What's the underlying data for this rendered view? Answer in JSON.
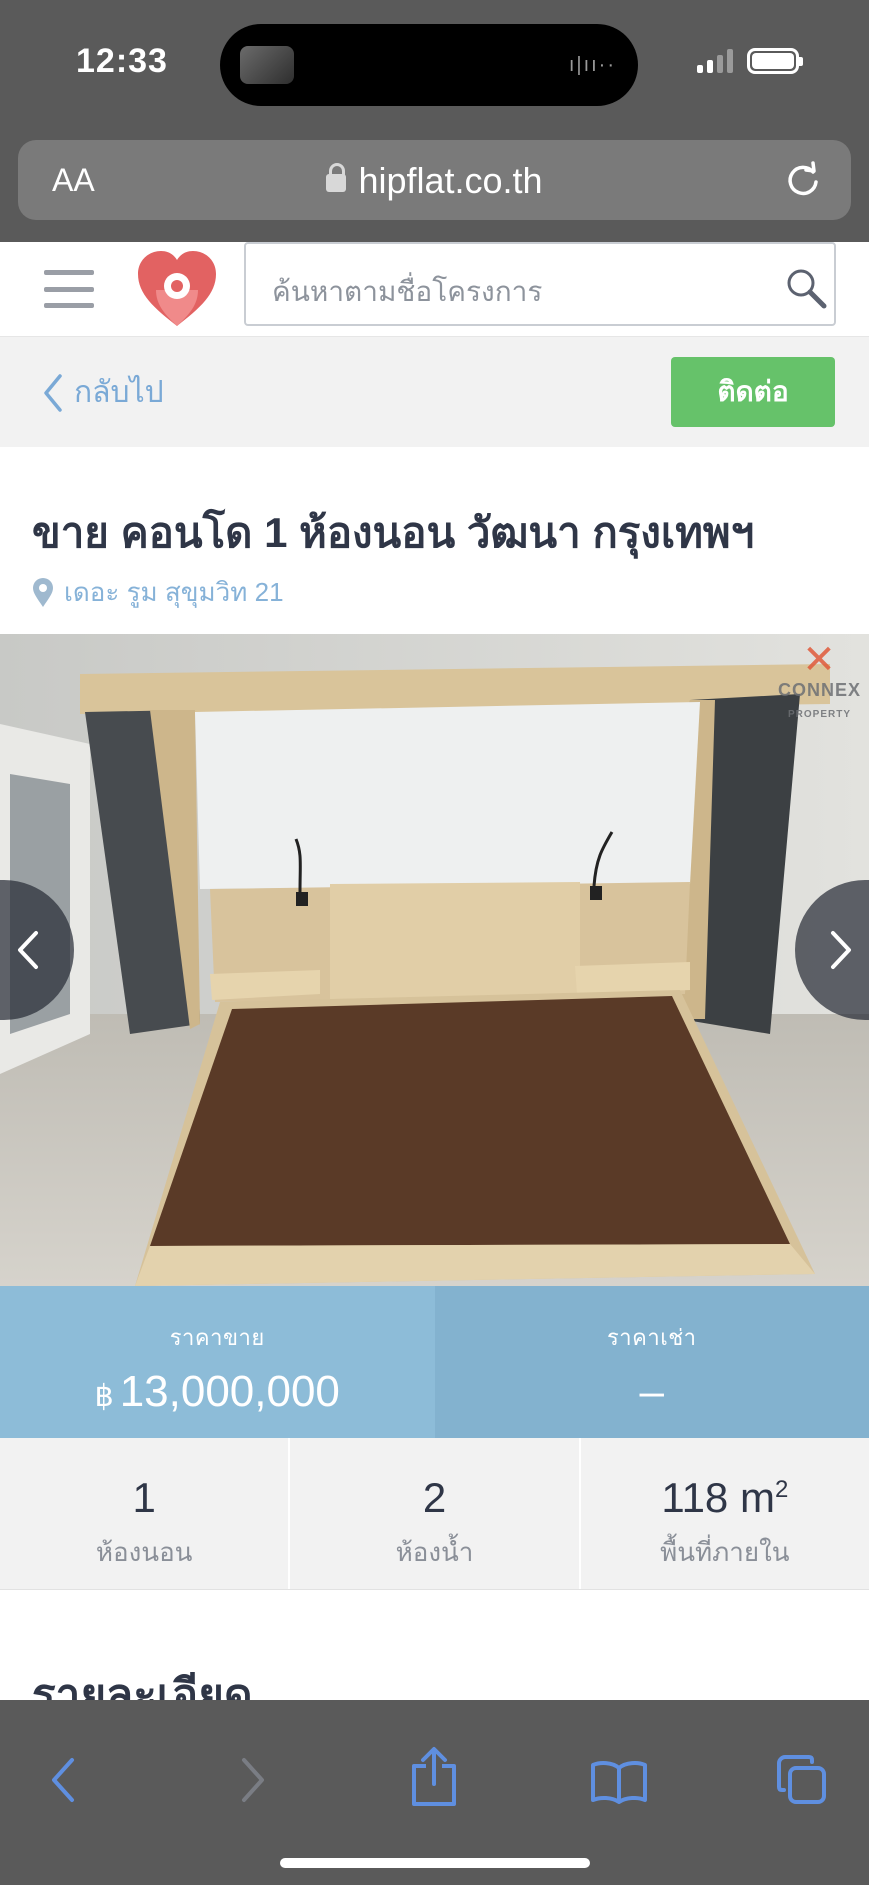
{
  "status_bar": {
    "time": "12:33"
  },
  "browser": {
    "aa_label": "AA",
    "url": "hipflat.co.th"
  },
  "site": {
    "search_placeholder": "ค้นหาตามชื่อโครงการ"
  },
  "nav": {
    "back_label": "กลับไป",
    "contact_label": "ติดต่อ"
  },
  "listing": {
    "title": "ขาย คอนโด 1 ห้องนอน วัฒนา กรุงเทพฯ",
    "location": "เดอะ รูม สุขุมวิท 21"
  },
  "photo": {
    "watermark": "CONNEX",
    "watermark_sub": "PROPERTY"
  },
  "price": {
    "sale_label": "ราคาขาย",
    "currency_symbol": "฿",
    "sale_value": "13,000,000",
    "rent_label": "ราคาเช่า",
    "rent_value": "–"
  },
  "stats": {
    "bedrooms_value": "1",
    "bedrooms_label": "ห้องนอน",
    "bathrooms_value": "2",
    "bathrooms_label": "ห้องน้ำ",
    "area_value": "118 m",
    "area_unit_sup": "2",
    "area_label": "พื้นที่ภายใน"
  },
  "sections": {
    "details_heading": "รายละเอียด"
  },
  "colors": {
    "accent_green": "#66c26a",
    "price_blue": "#8dbcd8",
    "link_blue": "#7aa9d6",
    "toolbar_icon_blue": "#5f8fe0"
  }
}
